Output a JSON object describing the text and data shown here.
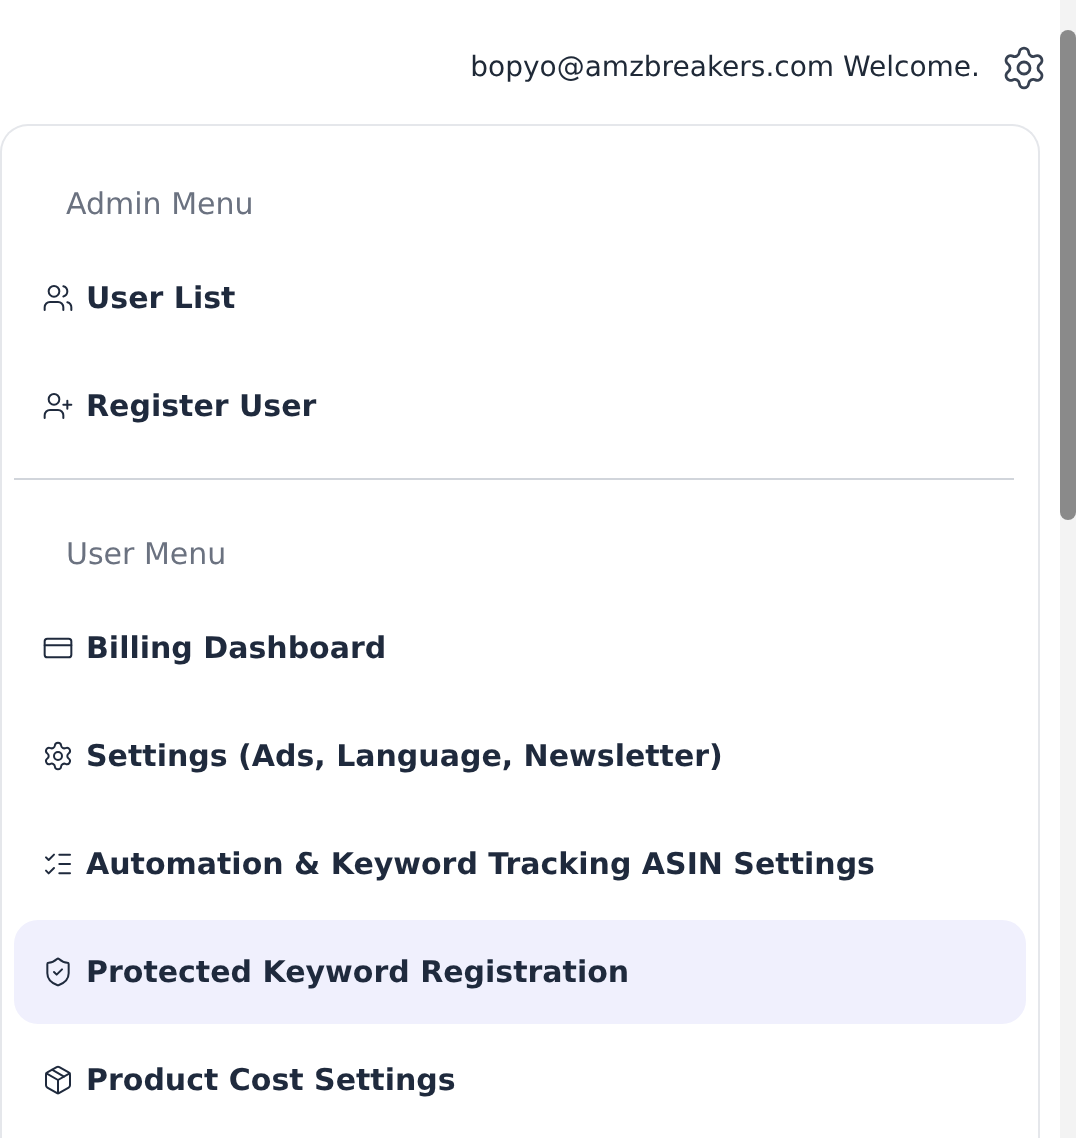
{
  "header": {
    "user": "bopyo@amzbreakers.com Welcome."
  },
  "sections": [
    {
      "title": "Admin Menu",
      "items": [
        {
          "label": "User List",
          "selected": false
        },
        {
          "label": "Register User",
          "selected": false
        }
      ]
    },
    {
      "title": "User Menu",
      "items": [
        {
          "label": "Billing Dashboard",
          "selected": false
        },
        {
          "label": "Settings (Ads, Language, Newsletter)",
          "selected": false
        },
        {
          "label": "Automation & Keyword Tracking ASIN Settings",
          "selected": false
        },
        {
          "label": "Protected Keyword Registration",
          "selected": true
        },
        {
          "label": "Product Cost Settings",
          "selected": false
        }
      ]
    }
  ]
}
